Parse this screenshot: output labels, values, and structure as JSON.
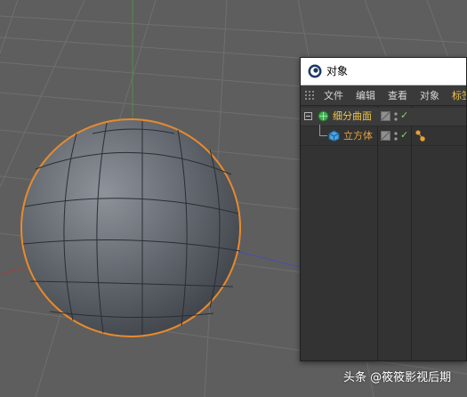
{
  "viewport": {
    "background": "#5e5e5e",
    "grid_color": "#6c6c6c",
    "sphere_color": "#6b7077",
    "selection_outline_color": "#e88a2c"
  },
  "object_manager": {
    "title": "对象",
    "menu": [
      "文件",
      "编辑",
      "查看",
      "对象",
      "标签"
    ],
    "objects": [
      {
        "name": "细分曲面",
        "icon": "subdivision-surface-icon",
        "color": "#f2c84b",
        "visible": true
      },
      {
        "name": "立方体",
        "icon": "cube-icon",
        "color": "#e8a23a",
        "visible": true
      }
    ],
    "active_menu_color": "#f0c24a"
  },
  "watermark": "头条 @筱筱影视后期"
}
